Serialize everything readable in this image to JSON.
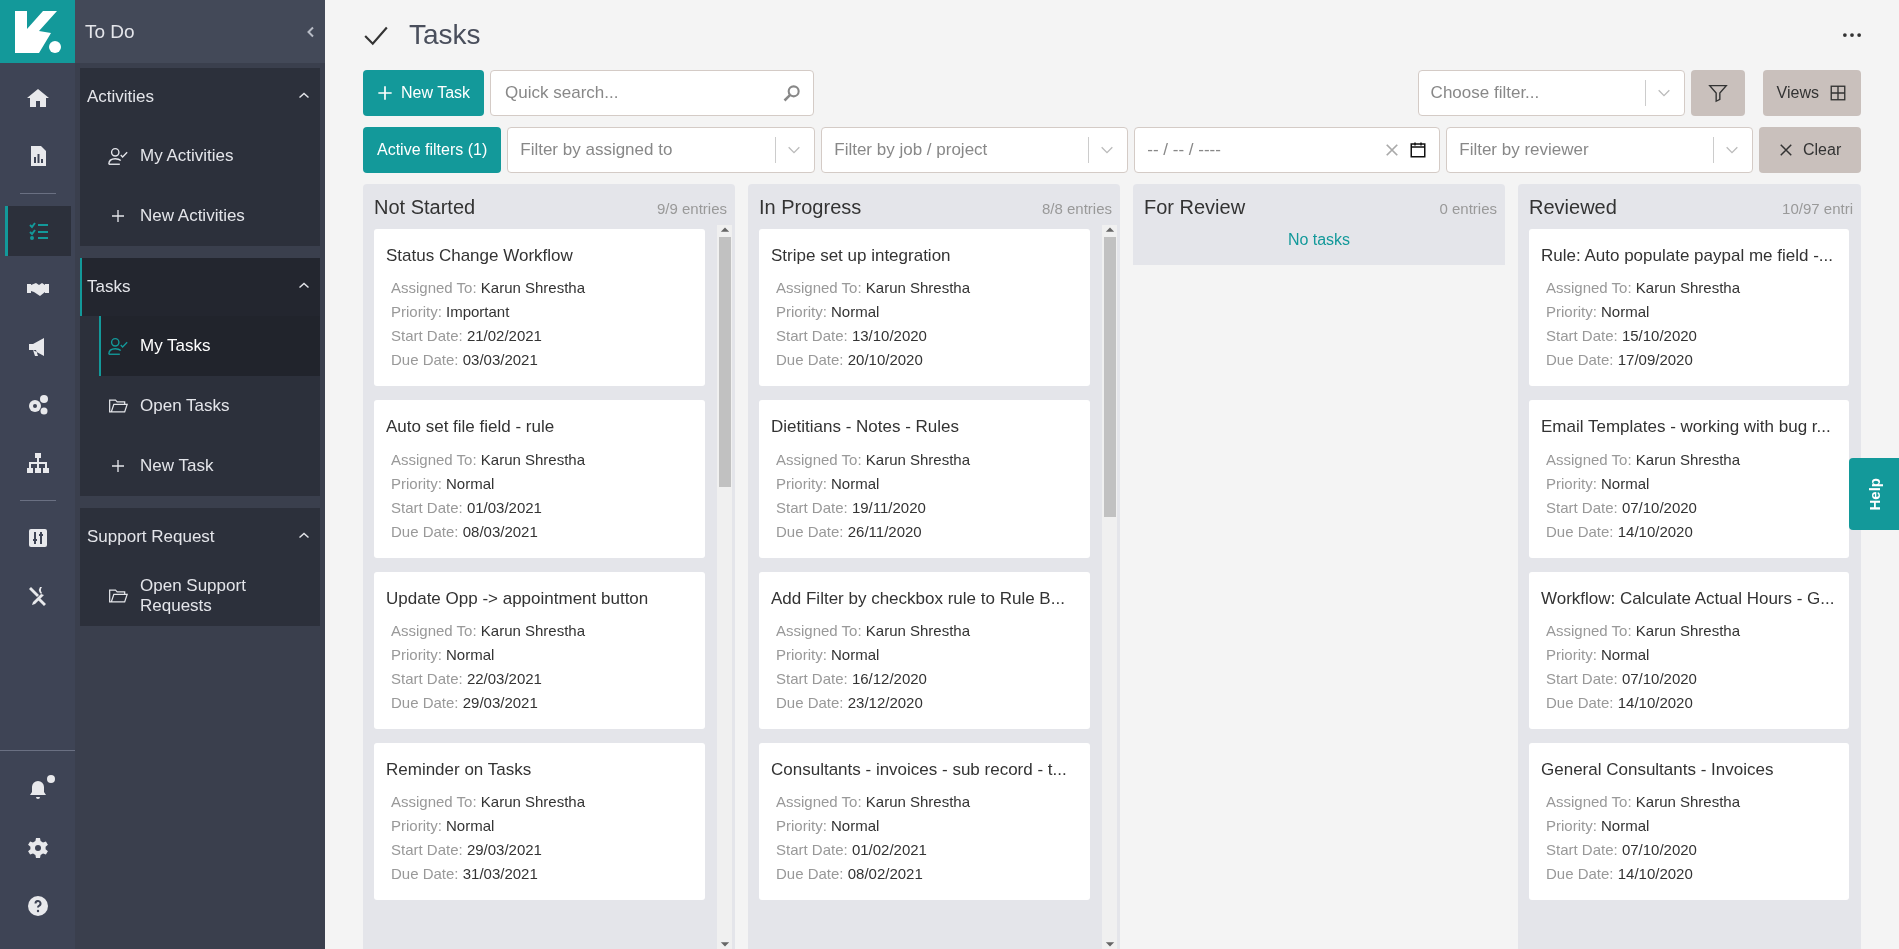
{
  "rail": {
    "items": [
      {
        "selected": false,
        "unread": false
      },
      {
        "selected": false,
        "unread": false
      },
      {
        "selected": true,
        "unread": false
      },
      {
        "selected": false,
        "unread": false
      },
      {
        "selected": false,
        "unread": false
      },
      {
        "selected": false,
        "unread": false
      },
      {
        "selected": false,
        "unread": false
      },
      {
        "selected": false,
        "unread": false
      },
      {
        "selected": false,
        "unread": false
      }
    ],
    "bottom_items": [
      {
        "selected": false,
        "unread": true
      },
      {
        "selected": false,
        "unread": false
      },
      {
        "selected": false,
        "unread": false
      }
    ]
  },
  "sidebar": {
    "title": "To Do",
    "sections": [
      {
        "label": "Activities",
        "expanded": true,
        "selected": false,
        "items": [
          {
            "label": "My Activities",
            "kind": "person",
            "selected": false
          },
          {
            "label": "New Activities",
            "kind": "add",
            "selected": false
          }
        ]
      },
      {
        "label": "Tasks",
        "expanded": true,
        "selected": true,
        "items": [
          {
            "label": "My Tasks",
            "kind": "person",
            "selected": true
          },
          {
            "label": "Open Tasks",
            "kind": "folder",
            "selected": false
          },
          {
            "label": "New Task",
            "kind": "add",
            "selected": false
          }
        ]
      },
      {
        "label": "Support Request",
        "expanded": true,
        "selected": false,
        "items": [
          {
            "label": "Open Support Requests",
            "kind": "folder",
            "selected": false
          }
        ]
      }
    ]
  },
  "page": {
    "title": "Tasks"
  },
  "toolbar": {
    "new_button": "New Task",
    "search": {
      "placeholder": "Quick search..."
    },
    "choose_filter": {
      "placeholder": "Choose filter..."
    },
    "views_button": "Views"
  },
  "filters": {
    "active_button": "Active filters (1)",
    "assigned": {
      "placeholder": "Filter by assigned to"
    },
    "job": {
      "placeholder": "Filter by job / project"
    },
    "date": {
      "placeholder": "-- / -- / ----"
    },
    "reviewer": {
      "placeholder": "Filter by reviewer"
    },
    "clear_button": "Clear"
  },
  "columns": [
    {
      "name": "Not Started",
      "count": "9/9 entries",
      "cards": [
        {
          "title": "Status Change Workflow",
          "fields": [
            {
              "label": "Assigned To:",
              "value": "Karun Shrestha"
            },
            {
              "label": "Priority:",
              "value": "Important"
            },
            {
              "label": "Start Date:",
              "value": "21/02/2021"
            },
            {
              "label": "Due Date:",
              "value": "03/03/2021"
            }
          ]
        },
        {
          "title": "Auto set file field - rule",
          "fields": [
            {
              "label": "Assigned To:",
              "value": "Karun Shrestha"
            },
            {
              "label": "Priority:",
              "value": "Normal"
            },
            {
              "label": "Start Date:",
              "value": "01/03/2021"
            },
            {
              "label": "Due Date:",
              "value": "08/03/2021"
            }
          ]
        },
        {
          "title": "Update Opp -> appointment button",
          "fields": [
            {
              "label": "Assigned To:",
              "value": "Karun Shrestha"
            },
            {
              "label": "Priority:",
              "value": "Normal"
            },
            {
              "label": "Start Date:",
              "value": "22/03/2021"
            },
            {
              "label": "Due Date:",
              "value": "29/03/2021"
            }
          ]
        },
        {
          "title": "Reminder on Tasks",
          "fields": [
            {
              "label": "Assigned To:",
              "value": "Karun Shrestha"
            },
            {
              "label": "Priority:",
              "value": "Normal"
            },
            {
              "label": "Start Date:",
              "value": "29/03/2021"
            },
            {
              "label": "Due Date:",
              "value": "31/03/2021"
            }
          ]
        }
      ]
    },
    {
      "name": "In Progress",
      "count": "8/8 entries",
      "cards": [
        {
          "title": "Stripe set up integration",
          "fields": [
            {
              "label": "Assigned To:",
              "value": "Karun Shrestha"
            },
            {
              "label": "Priority:",
              "value": "Normal"
            },
            {
              "label": "Start Date:",
              "value": "13/10/2020"
            },
            {
              "label": "Due Date:",
              "value": "20/10/2020"
            }
          ]
        },
        {
          "title": "Dietitians - Notes - Rules",
          "fields": [
            {
              "label": "Assigned To:",
              "value": "Karun Shrestha"
            },
            {
              "label": "Priority:",
              "value": "Normal"
            },
            {
              "label": "Start Date:",
              "value": "19/11/2020"
            },
            {
              "label": "Due Date:",
              "value": "26/11/2020"
            }
          ]
        },
        {
          "title": "Add Filter by checkbox rule to Rule B...",
          "fields": [
            {
              "label": "Assigned To:",
              "value": "Karun Shrestha"
            },
            {
              "label": "Priority:",
              "value": "Normal"
            },
            {
              "label": "Start Date:",
              "value": "16/12/2020"
            },
            {
              "label": "Due Date:",
              "value": "23/12/2020"
            }
          ]
        },
        {
          "title": "Consultants - invoices - sub record - t...",
          "fields": [
            {
              "label": "Assigned To:",
              "value": "Karun Shrestha"
            },
            {
              "label": "Priority:",
              "value": "Normal"
            },
            {
              "label": "Start Date:",
              "value": "01/02/2021"
            },
            {
              "label": "Due Date:",
              "value": "08/02/2021"
            }
          ]
        }
      ]
    },
    {
      "name": "For Review",
      "count": "0 entries",
      "empty_text": "No tasks"
    },
    {
      "name": "Reviewed",
      "count": "10/97 entri",
      "cards": [
        {
          "title": "Rule: Auto populate paypal me field -...",
          "fields": [
            {
              "label": "Assigned To:",
              "value": "Karun Shrestha"
            },
            {
              "label": "Priority:",
              "value": "Normal"
            },
            {
              "label": "Start Date:",
              "value": "15/10/2020"
            },
            {
              "label": "Due Date:",
              "value": "17/09/2020"
            }
          ]
        },
        {
          "title": "Email Templates - working with bug r...",
          "fields": [
            {
              "label": "Assigned To:",
              "value": "Karun Shrestha"
            },
            {
              "label": "Priority:",
              "value": "Normal"
            },
            {
              "label": "Start Date:",
              "value": "07/10/2020"
            },
            {
              "label": "Due Date:",
              "value": "14/10/2020"
            }
          ]
        },
        {
          "title": "Workflow: Calculate Actual Hours - G...",
          "fields": [
            {
              "label": "Assigned To:",
              "value": "Karun Shrestha"
            },
            {
              "label": "Priority:",
              "value": "Normal"
            },
            {
              "label": "Start Date:",
              "value": "07/10/2020"
            },
            {
              "label": "Due Date:",
              "value": "14/10/2020"
            }
          ]
        },
        {
          "title": "General Consultants - Invoices",
          "fields": [
            {
              "label": "Assigned To:",
              "value": "Karun Shrestha"
            },
            {
              "label": "Priority:",
              "value": "Normal"
            },
            {
              "label": "Start Date:",
              "value": "07/10/2020"
            },
            {
              "label": "Due Date:",
              "value": "14/10/2020"
            }
          ]
        }
      ]
    }
  ],
  "help_tab": "Help"
}
